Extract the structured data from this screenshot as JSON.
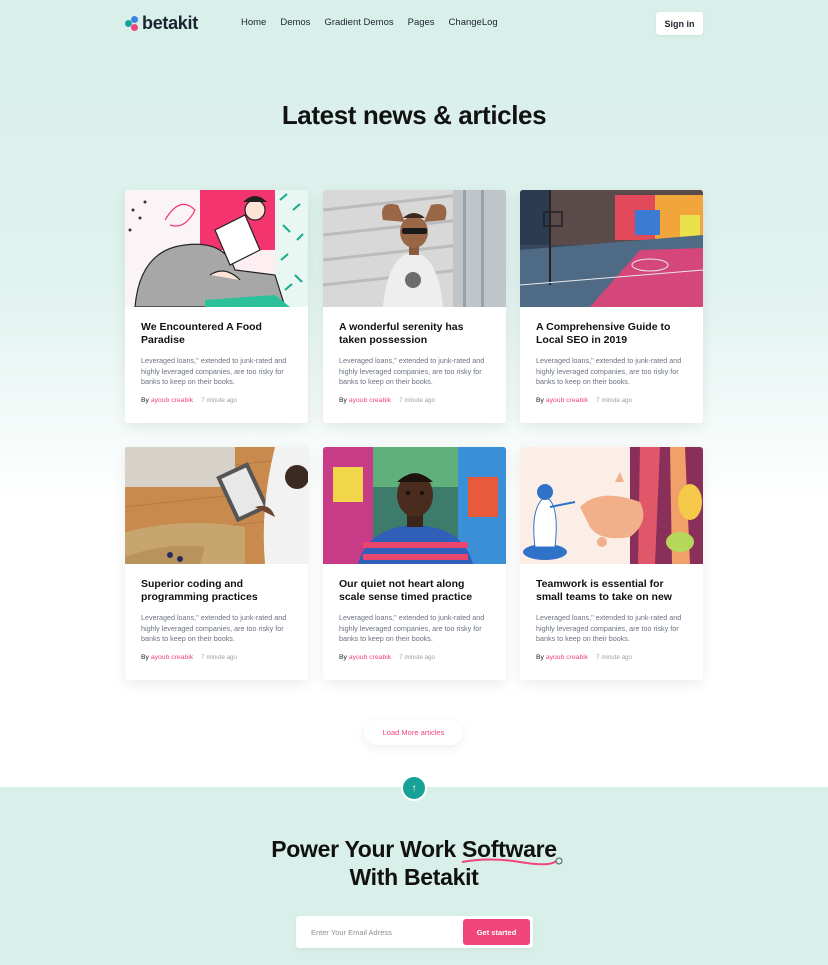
{
  "brand": {
    "name": "betakit"
  },
  "nav": {
    "links": [
      "Home",
      "Demos",
      "Gradient Demos",
      "Pages",
      "ChangeLog"
    ],
    "signin_label": "Sign in"
  },
  "section": {
    "title": "Latest news & articles"
  },
  "articles": [
    {
      "title": "We Encountered A Food Paradise",
      "excerpt": "Leveraged loans,\" extended to junk-rated and highly leveraged companies, are too risky for banks to keep on their books.",
      "by": "By",
      "author": "ayoub creabik",
      "time": "7 minute ago"
    },
    {
      "title": "A wonderful serenity has taken possession",
      "excerpt": "Leveraged loans,\" extended to junk-rated and highly leveraged companies, are too risky for banks to keep on their books.",
      "by": "By",
      "author": "ayoub creabik",
      "time": "7 minute ago"
    },
    {
      "title": "A Comprehensive Guide to Local SEO in 2019",
      "excerpt": "Leveraged loans,\" extended to junk-rated and highly leveraged companies, are too risky for banks to keep on their books.",
      "by": "By",
      "author": "ayoub creabik",
      "time": "7 minute ago"
    },
    {
      "title": "Superior coding and programming practices",
      "excerpt": "Leveraged loans,\" extended to junk-rated and highly leveraged companies, are too risky for banks to keep on their books.",
      "by": "By",
      "author": "ayoub creabik",
      "time": "7 minute ago"
    },
    {
      "title": "Our quiet not heart along scale sense timed practice",
      "excerpt": "Leveraged loans,\" extended to junk-rated and highly leveraged companies, are too risky for banks to keep on their books.",
      "by": "By",
      "author": "ayoub creabik",
      "time": "7 minute ago"
    },
    {
      "title": "Teamwork is essential for small teams to take on new",
      "excerpt": "Leveraged loans,\" extended to junk-rated and highly leveraged companies, are too risky for banks to keep on their books.",
      "by": "By",
      "author": "ayoub creabik",
      "time": "7 minute ago"
    }
  ],
  "load_more_label": "Load More articles",
  "scroll_top_icon": "arrow-up-icon",
  "cta": {
    "line1_before": "Power Your Work ",
    "line1_highlight": "Software",
    "line2": "With Betakit",
    "email_placeholder": "Enter Your Email Adress",
    "button_label": "Get started"
  },
  "colors": {
    "accent": "#f0457a",
    "teal": "#18a197",
    "background": "#d9efea"
  }
}
